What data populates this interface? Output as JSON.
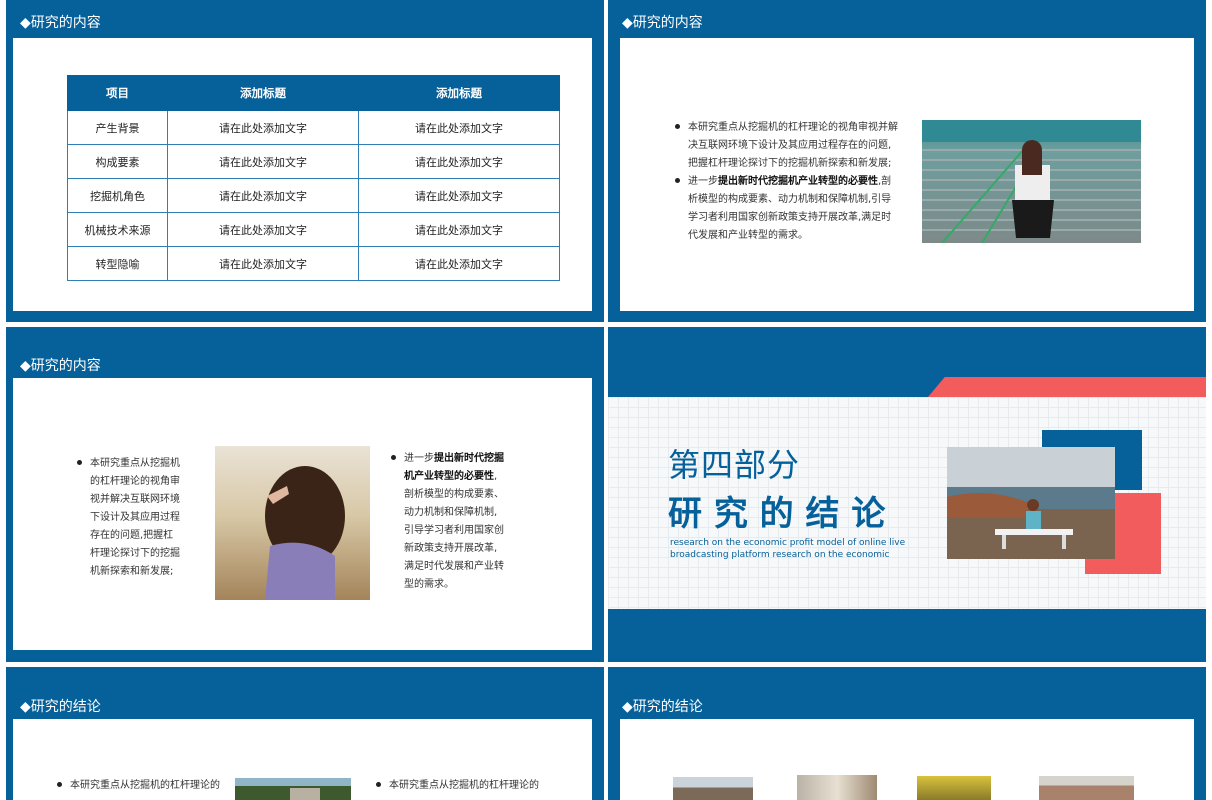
{
  "slide1": {
    "title": "◆研究的内容",
    "table": {
      "headers": [
        "项目",
        "添加标题",
        "添加标题"
      ],
      "rows": [
        [
          "产生背景",
          "请在此处添加文字",
          "请在此处添加文字"
        ],
        [
          "构成要素",
          "请在此处添加文字",
          "请在此处添加文字"
        ],
        [
          "挖掘机角色",
          "请在此处添加文字",
          "请在此处添加文字"
        ],
        [
          "机械技术来源",
          "请在此处添加文字",
          "请在此处添加文字"
        ],
        [
          "转型隐喻",
          "请在此处添加文字",
          "请在此处添加文字"
        ]
      ]
    }
  },
  "slide2": {
    "title": "◆研究的内容",
    "b1": [
      "本研究重点从挖掘机的杠杆理论的视角审视并解",
      "决互联网环境下设计及其应用过程存在的问题,",
      "把握杠杆理论探讨下的挖掘机新探索和新发展;"
    ],
    "b2_pre": "进一步",
    "b2_bold": "提出新时代挖掘机产业转型的必要性",
    "b2_post": ",剖",
    "b2": [
      "析模型的构成要素、动力机制和保障机制,引导",
      "学习者利用国家创新政策支持开展改革,满足时",
      "代发展和产业转型的需求。"
    ]
  },
  "slide3": {
    "title": "◆研究的内容",
    "left": [
      "本研究重点从挖掘机",
      "的杠杆理论的视角审",
      "视并解决互联网环境",
      "下设计及其应用过程",
      "存在的问题,把握杠",
      "杆理论探讨下的挖掘",
      "机新探索和新发展;"
    ],
    "right_pre": "进一步",
    "right_bold1": "提出新时代挖掘",
    "right_bold2": "机产业转型的必要性",
    "right_post": ",",
    "right": [
      "剖析模型的构成要素、",
      "动力机制和保障机制,",
      "引导学习者利用国家创",
      "新政策支持开展改革,",
      "满足时代发展和产业转",
      "型的需求。"
    ]
  },
  "slide4": {
    "part": "第四部分",
    "heading": "研 究 的 结 论",
    "en1": "research on the economic profit model of online live",
    "en2": "broadcasting platform research on the economic",
    "colors": {
      "accent": "#f25c5c",
      "blue": "#06609a"
    }
  },
  "slide5": {
    "title": "◆研究的结论",
    "b1": "本研究重点从挖掘机的杠杆理论的",
    "b2": "本研究重点从挖掘机的杠杆理论的"
  },
  "slide6": {
    "title": "◆研究的结论"
  }
}
